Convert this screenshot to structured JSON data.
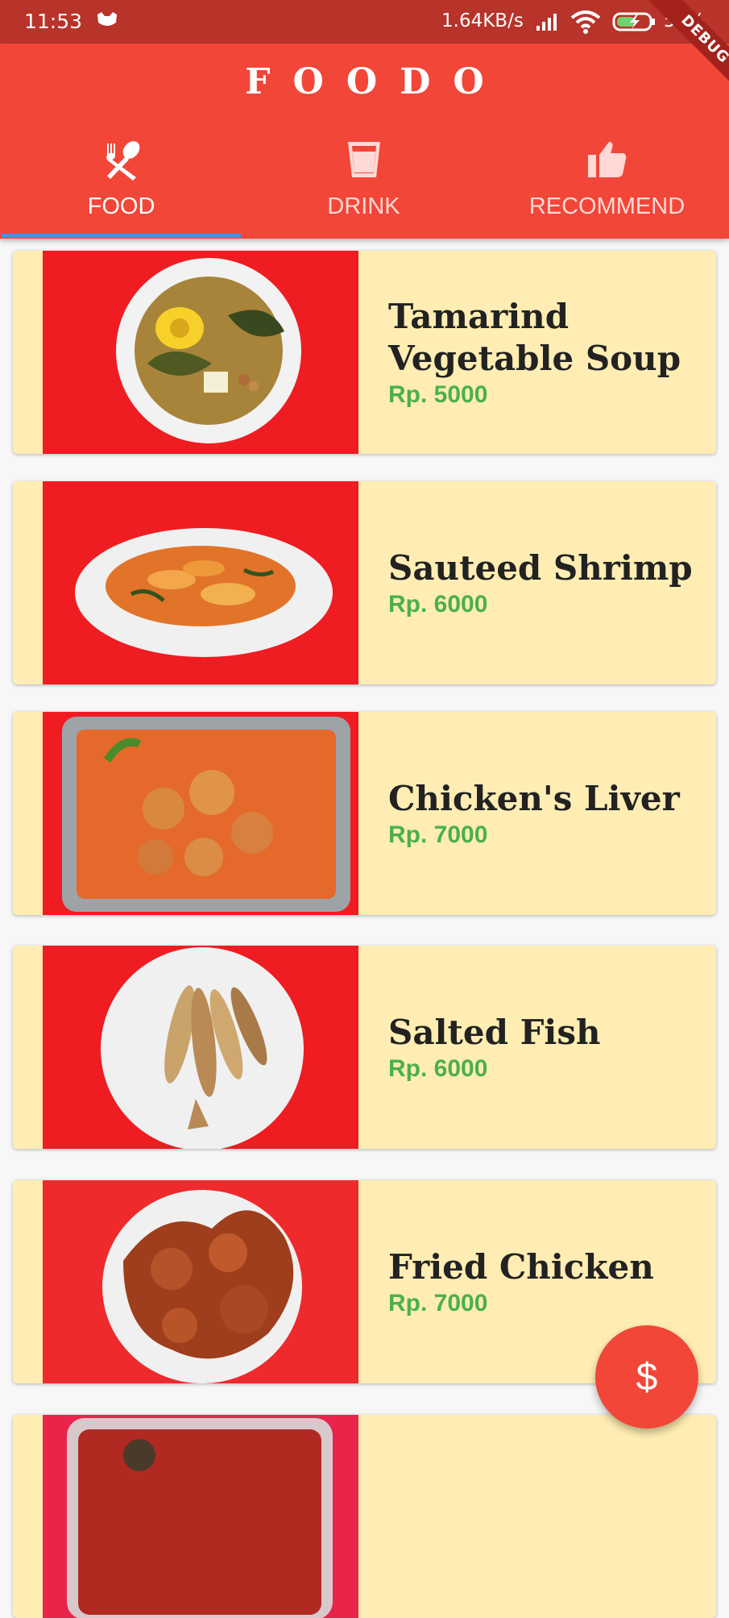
{
  "status_bar": {
    "time": "11:53",
    "speed": "1.64KB/s",
    "battery": "58%"
  },
  "debug_banner": "DEBUG",
  "app_bar": {
    "title": "FOODO",
    "tabs": [
      {
        "label": "FOOD",
        "icon": "fork-spoon-icon",
        "selected": true
      },
      {
        "label": "DRINK",
        "icon": "cup-icon",
        "selected": false
      },
      {
        "label": "RECOMMEND",
        "icon": "thumbs-up-icon",
        "selected": false
      }
    ]
  },
  "foods": [
    {
      "name": "Tamarind Vegetable Soup",
      "price": "Rp. 5000",
      "image": "soup-bowl"
    },
    {
      "name": "Sauteed Shrimp",
      "price": "Rp. 6000",
      "image": "shrimp-plate"
    },
    {
      "name": "Chicken's Liver",
      "price": "Rp. 7000",
      "image": "liver-tray"
    },
    {
      "name": "Salted Fish",
      "price": "Rp. 6000",
      "image": "fish-plate"
    },
    {
      "name": "Fried Chicken",
      "price": "Rp. 7000",
      "image": "chicken-plate"
    },
    {
      "name": "",
      "price": "",
      "image": "partial-dish"
    }
  ],
  "fab": {
    "label": "$"
  },
  "colors": {
    "primary": "#f24638",
    "card_background": "#ffedb3",
    "price_green": "#4caf50",
    "tab_indicator": "#4a8fe0"
  }
}
